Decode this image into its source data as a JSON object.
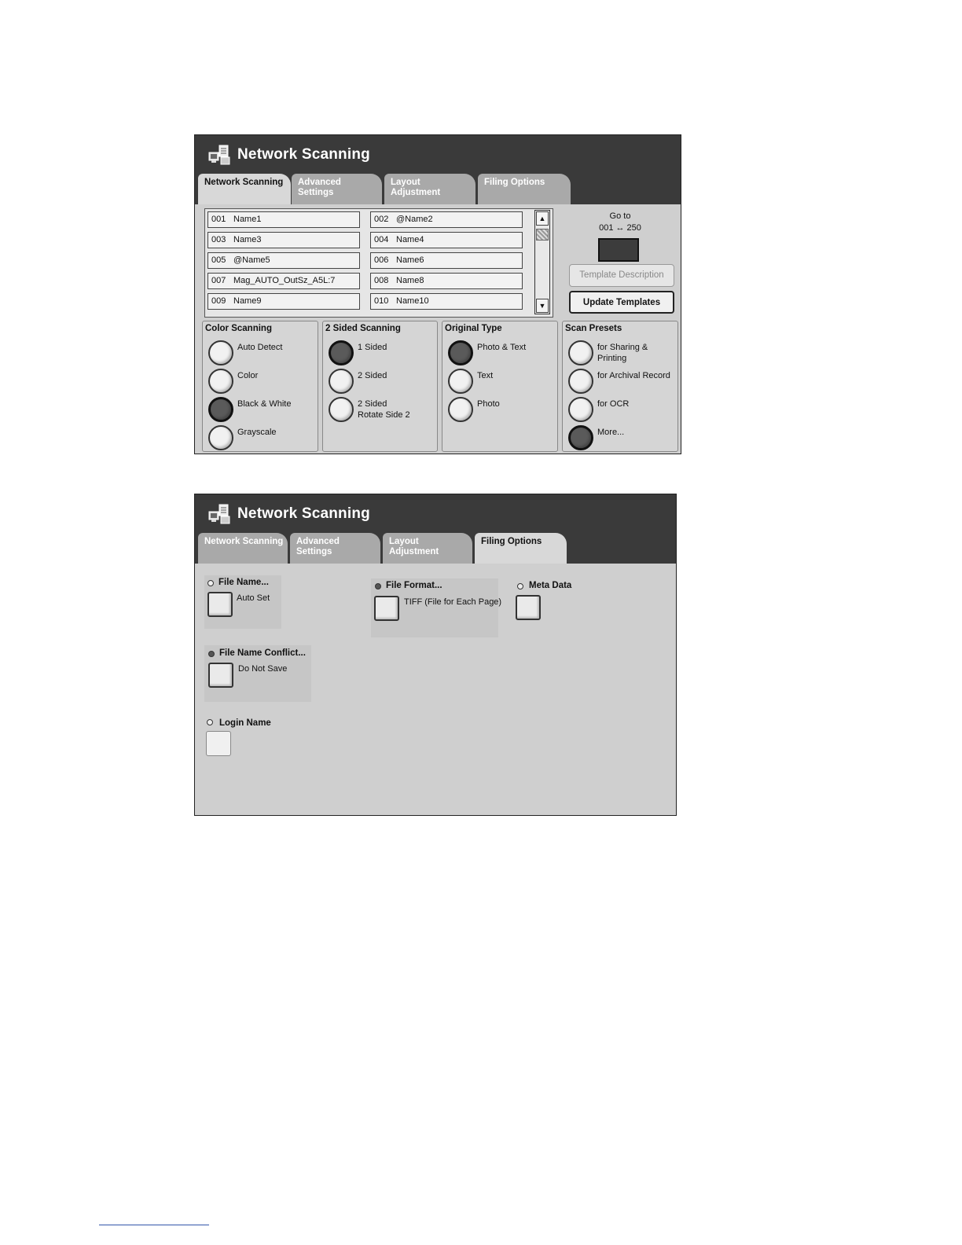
{
  "screen1": {
    "title": "Network Scanning",
    "tabs": [
      {
        "label": "Network Scanning",
        "active": true
      },
      {
        "label": "Advanced\nSettings"
      },
      {
        "label": "Layout\nAdjustment"
      },
      {
        "label": "Filing Options"
      }
    ],
    "templates": [
      {
        "num": "001",
        "name": "Name1"
      },
      {
        "num": "002",
        "name": "@Name2"
      },
      {
        "num": "003",
        "name": "Name3"
      },
      {
        "num": "004",
        "name": "Name4"
      },
      {
        "num": "005",
        "name": "@Name5"
      },
      {
        "num": "006",
        "name": "Name6"
      },
      {
        "num": "007",
        "name": "Mag_AUTO_OutSz_A5L:7"
      },
      {
        "num": "008",
        "name": "Name8"
      },
      {
        "num": "009",
        "name": "Name9"
      },
      {
        "num": "010",
        "name": "Name10"
      }
    ],
    "goto": {
      "label": "Go to",
      "range": "001 ↔ 250"
    },
    "template_description": "Template Description",
    "update_templates": "Update Templates",
    "color_scanning": {
      "title": "Color Scanning",
      "options": [
        "Auto Detect",
        "Color",
        "Black & White",
        "Grayscale"
      ],
      "selected": "Black & White"
    },
    "sided_scanning": {
      "title": "2 Sided Scanning",
      "options": [
        "1 Sided",
        "2 Sided",
        "2 Sided\nRotate Side 2"
      ],
      "selected": "1 Sided"
    },
    "original_type": {
      "title": "Original Type",
      "options": [
        "Photo & Text",
        "Text",
        "Photo"
      ],
      "selected": "Photo & Text"
    },
    "scan_presets": {
      "title": "Scan Presets",
      "options": [
        "for Sharing &\nPrinting",
        "for Archival Record",
        "for OCR",
        "More..."
      ],
      "selected": "More..."
    }
  },
  "screen2": {
    "title": "Network Scanning",
    "tabs": [
      {
        "label": "Network Scanning"
      },
      {
        "label": "Advanced\nSettings"
      },
      {
        "label": "Layout\nAdjustment"
      },
      {
        "label": "Filing Options",
        "active": true
      }
    ],
    "file_name": {
      "title": "File Name...",
      "value": "Auto Set"
    },
    "file_format": {
      "title": "File Format...",
      "value": "TIFF (File for Each Page)"
    },
    "meta_data": {
      "title": "Meta Data"
    },
    "file_name_conflict": {
      "title": "File Name Conflict...",
      "value": "Do Not Save"
    },
    "login_name": {
      "title": "Login Name"
    }
  }
}
